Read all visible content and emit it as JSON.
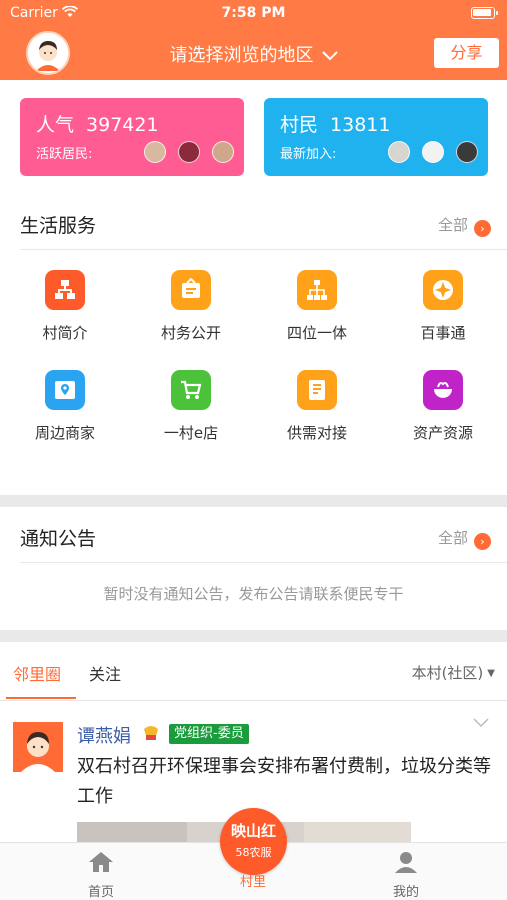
{
  "status_bar": {
    "carrier": "Carrier",
    "time": "7:58 PM"
  },
  "header": {
    "region_prompt": "请选择浏览的地区",
    "share_label": "分享"
  },
  "stats": {
    "popularity": {
      "label": "人气",
      "value": "397421",
      "sub_label": "活跃居民:"
    },
    "villagers": {
      "label": "村民",
      "value": "13811",
      "sub_label": "最新加入:"
    }
  },
  "life_services": {
    "title": "生活服务",
    "all_label": "全部",
    "items": [
      {
        "label": "村简介",
        "icon": "org-chart-icon",
        "color": "#ff5a2a"
      },
      {
        "label": "村务公开",
        "icon": "notice-board-icon",
        "color": "#ffa21a"
      },
      {
        "label": "四位一体",
        "icon": "hierarchy-icon",
        "color": "#ffa21a"
      },
      {
        "label": "百事通",
        "icon": "compass-icon",
        "color": "#ffa21a"
      },
      {
        "label": "周边商家",
        "icon": "map-pin-icon",
        "color": "#2aa3f0"
      },
      {
        "label": "一村e店",
        "icon": "cart-icon",
        "color": "#4cc23a"
      },
      {
        "label": "供需对接",
        "icon": "document-icon",
        "color": "#ffa21a"
      },
      {
        "label": "资产资源",
        "icon": "bowl-icon",
        "color": "#c023c8"
      }
    ]
  },
  "notices": {
    "title": "通知公告",
    "all_label": "全部",
    "empty_text": "暂时没有通知公告，发布公告请联系便民专干"
  },
  "feed_tabs": {
    "tab1": "邻里圈",
    "tab2": "关注",
    "scope": "本村(社区)"
  },
  "post": {
    "author": "谭燕娟",
    "role_tag": "党组织-委员",
    "text": "双石村召开环保理事会安排布署付费制，垃圾分类等工作"
  },
  "center_button": {
    "line1": "映山红",
    "line2": "58农服"
  },
  "bottom_nav": {
    "home": "首页",
    "village": "村里",
    "mine": "我的"
  },
  "colors": {
    "accent": "#ff7a45",
    "pink_card": "#ff5c93",
    "blue_card": "#1fb2ef",
    "tag_green": "#1a9b3c"
  }
}
